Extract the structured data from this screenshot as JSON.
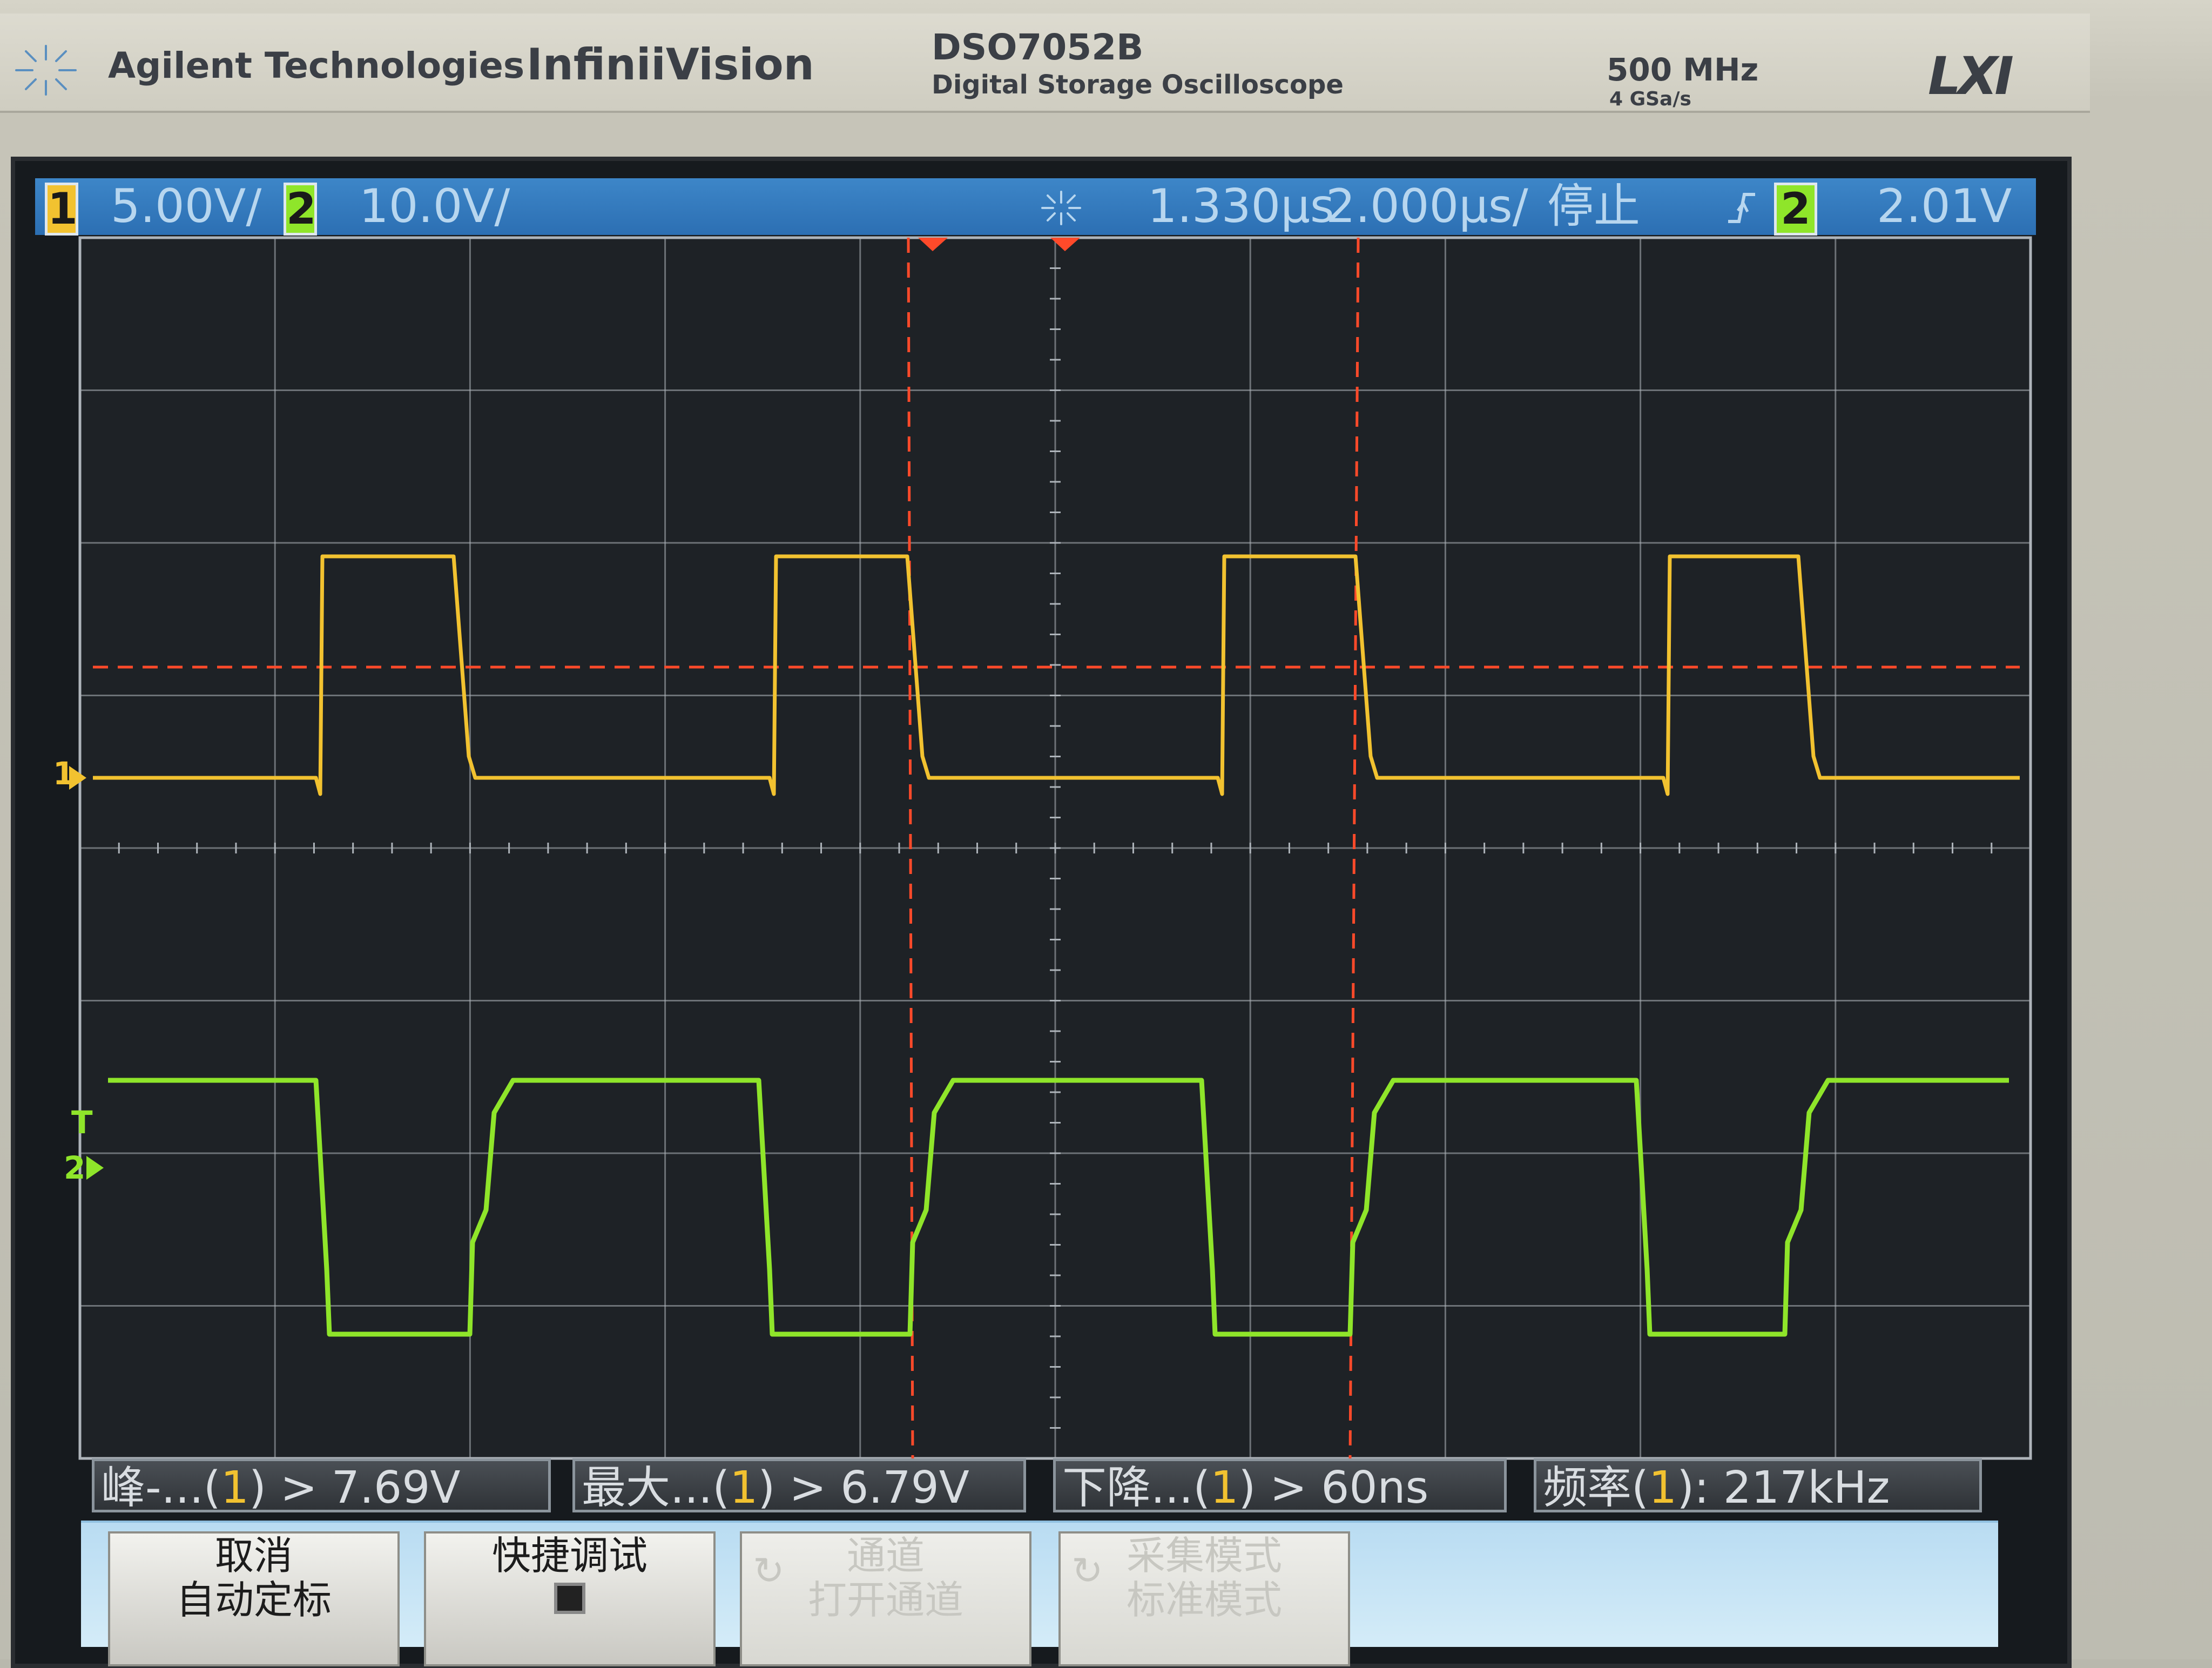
{
  "brand": {
    "company": "Agilent Technologies",
    "series": "InfiniiVision",
    "model": "DSO7052B",
    "model_desc": "Digital Storage Oscilloscope",
    "bandwidth": "500 MHz",
    "sample_rate": "4 GSa/s",
    "lxi": "LXI"
  },
  "status": {
    "ch1_label": "1",
    "ch1_scale": "5.00V/",
    "ch2_label": "2",
    "ch2_scale": "10.0V/",
    "time_delay": "1.330µs",
    "time_scale": "2.000µs/",
    "run_state": "停止",
    "trigger_source": "2",
    "trigger_level": "2.01V"
  },
  "markers": {
    "ch1": "1",
    "ch2": "2",
    "trigger": "T"
  },
  "colors": {
    "ch1": "#f2c230",
    "ch2": "#8fe52a",
    "cursor": "#ff4a2a",
    "grid": "#aeb4ba",
    "status_bar": "#3479bd"
  },
  "measurements": [
    {
      "name": "峰-...",
      "channel": "1",
      "value": " > 7.69V"
    },
    {
      "name": "最大...",
      "channel": "1",
      "value": " > 6.79V"
    },
    {
      "name": "下降...",
      "channel": "1",
      "value": " > 60ns"
    },
    {
      "name": "频率",
      "channel": "1",
      "value": "): 217kHz"
    }
  ],
  "softkeys": [
    {
      "line1": "取消",
      "line2": "自动定标",
      "enabled": true
    },
    {
      "line1": "快捷调试",
      "line2": "",
      "enabled": true
    },
    {
      "line1": "通道",
      "line2": "打开通道",
      "enabled": false
    },
    {
      "line1": "采集模式",
      "line2": "标准模式",
      "enabled": false
    }
  ]
}
